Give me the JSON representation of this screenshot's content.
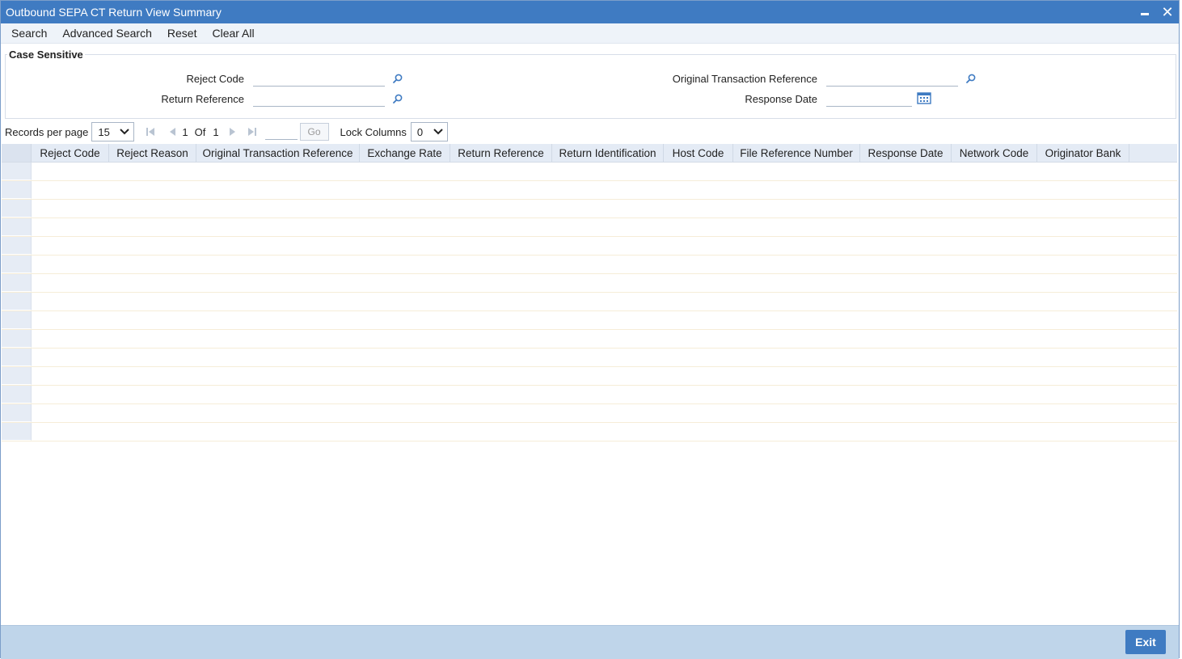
{
  "window": {
    "title": "Outbound SEPA CT Return View Summary"
  },
  "menu": {
    "items": [
      "Search",
      "Advanced Search",
      "Reset",
      "Clear All"
    ]
  },
  "criteria": {
    "legend": "Case Sensitive",
    "fields": {
      "reject_code": {
        "label": "Reject Code",
        "value": ""
      },
      "return_reference": {
        "label": "Return Reference",
        "value": ""
      },
      "original_transaction_reference": {
        "label": "Original Transaction Reference",
        "value": ""
      },
      "response_date": {
        "label": "Response Date",
        "value": ""
      }
    }
  },
  "pager": {
    "records_label": "Records per page",
    "records_value": "15",
    "current_page": "1",
    "of_label": "Of",
    "total_pages": "1",
    "go_label": "Go",
    "lock_label": "Lock Columns",
    "lock_value": "0"
  },
  "grid": {
    "columns": [
      {
        "key": "reject_code",
        "label": "Reject Code"
      },
      {
        "key": "reject_reason",
        "label": "Reject Reason"
      },
      {
        "key": "original_transaction_reference",
        "label": "Original Transaction Reference"
      },
      {
        "key": "exchange_rate",
        "label": "Exchange Rate"
      },
      {
        "key": "return_reference",
        "label": "Return Reference"
      },
      {
        "key": "return_identification",
        "label": "Return Identification"
      },
      {
        "key": "host_code",
        "label": "Host Code"
      },
      {
        "key": "file_reference_number",
        "label": "File Reference Number"
      },
      {
        "key": "response_date",
        "label": "Response Date"
      },
      {
        "key": "network_code",
        "label": "Network Code"
      },
      {
        "key": "originator_bank",
        "label": "Originator Bank"
      }
    ],
    "empty_rows": 15
  },
  "footer": {
    "exit_label": "Exit"
  },
  "icons": {
    "lov": "magnifier-icon",
    "calendar": "calendar-icon",
    "minimize": "minimize-icon",
    "close": "close-icon"
  },
  "colors": {
    "title_bar": "#3f7bc2",
    "footer": "#bfd5ea",
    "icon_blue": "#3f7bc2"
  }
}
